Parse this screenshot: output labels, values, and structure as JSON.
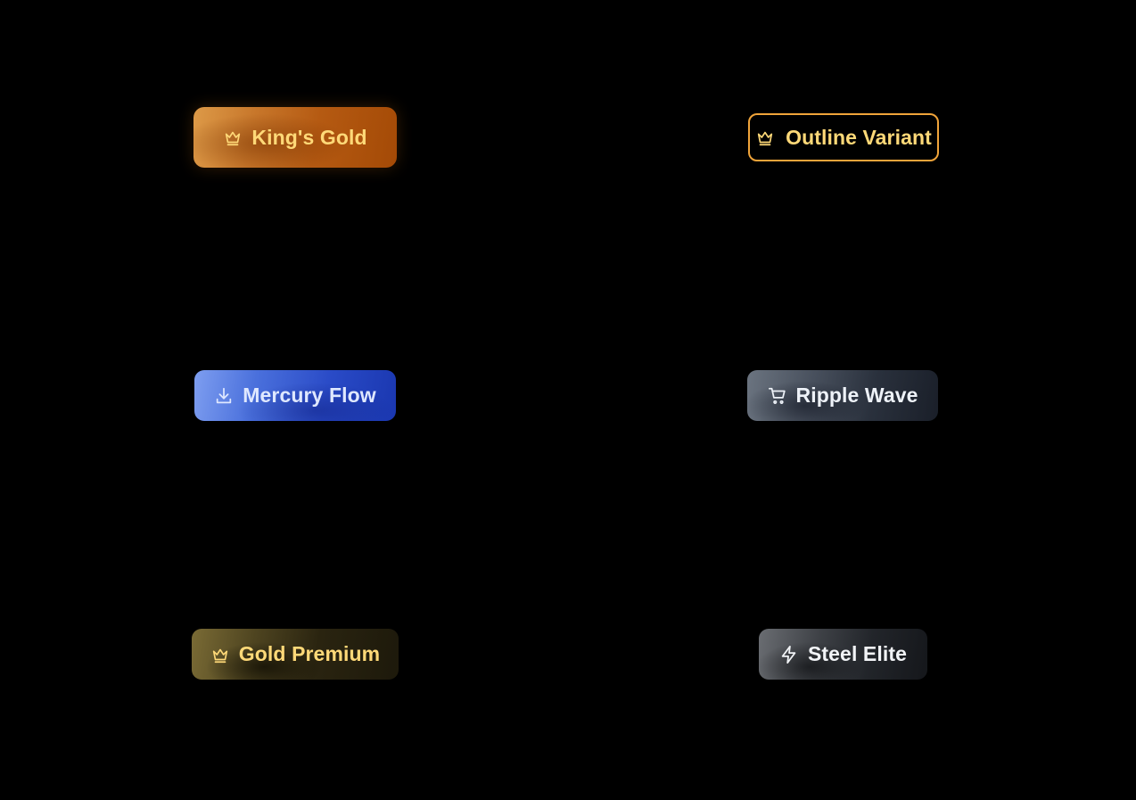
{
  "buttons": {
    "kings_gold": {
      "label": "King's Gold",
      "icon": "crown-icon",
      "color": "#ffd978"
    },
    "outline_variant": {
      "label": "Outline Variant",
      "icon": "crown-icon",
      "border_color": "#f0a43a",
      "color": "#ffd978"
    },
    "mercury_flow": {
      "label": "Mercury Flow",
      "icon": "download-icon",
      "color": "#dfe8ff"
    },
    "ripple_wave": {
      "label": "Ripple Wave",
      "icon": "shopping-cart-icon",
      "color": "#eef2f8"
    },
    "gold_premium": {
      "label": "Gold Premium",
      "icon": "crown-icon",
      "color": "#ffd978"
    },
    "steel_elite": {
      "label": "Steel Elite",
      "icon": "lightning-icon",
      "color": "#f2f4f7"
    }
  }
}
